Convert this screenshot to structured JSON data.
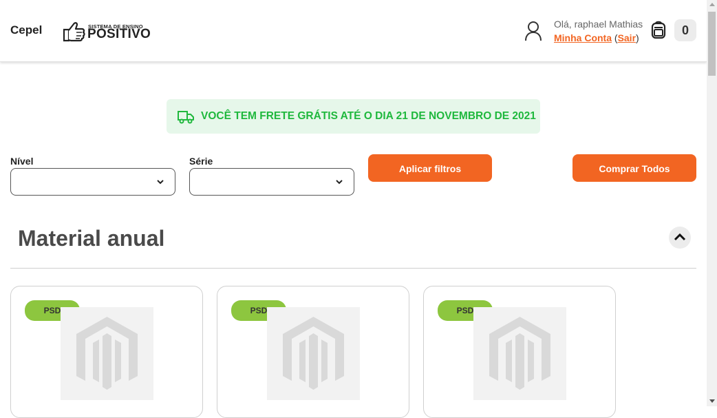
{
  "header": {
    "school_name": "Cepel",
    "logo": {
      "tagline": "SISTEMA DE ENSINO",
      "wordmark": "POSITIVO"
    },
    "greeting": "Olá, raphael Mathias",
    "account_link": "Minha Conta",
    "logout_link": "Sair",
    "cart_count": "0"
  },
  "banner": {
    "text": "VOCÊ TEM FRETE GRÁTIS ATÉ O DIA 21 DE NOVEMBRO DE 2021",
    "color": "#1fb83d"
  },
  "filters": {
    "nivel_label": "Nível",
    "nivel_value": "",
    "serie_label": "Série",
    "serie_value": "",
    "apply_label": "Aplicar filtros",
    "buy_all_label": "Comprar Todos"
  },
  "section": {
    "title": "Material anual"
  },
  "products": [
    {
      "badge": "PSD"
    },
    {
      "badge": "PSD"
    },
    {
      "badge": "PSD"
    }
  ],
  "colors": {
    "accent": "#f26522",
    "badge": "#8dc63f",
    "banner_bg": "#e6f7ea"
  },
  "icons": [
    "user-icon",
    "backpack-icon",
    "truck-icon",
    "chevron-down-icon",
    "chevron-up-icon",
    "magento-placeholder-icon"
  ]
}
